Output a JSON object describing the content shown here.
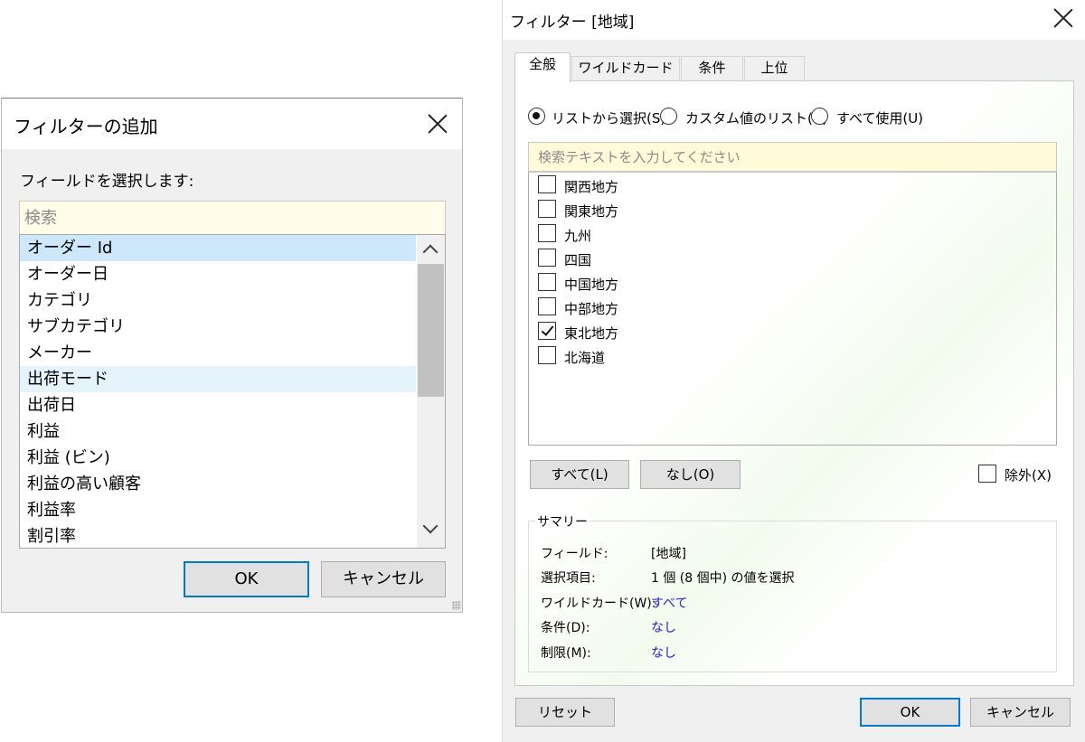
{
  "add_dialog": {
    "title": "フィルターの追加",
    "prompt": "フィールドを選択します:",
    "search_placeholder": "検索",
    "fields": [
      "オーダー Id",
      "オーダー日",
      "カテゴリ",
      "サブカテゴリ",
      "メーカー",
      "出荷モード",
      "出荷日",
      "利益",
      "利益 (ビン)",
      "利益の高い顧客",
      "利益率",
      "割引率"
    ],
    "selected_field": "オーダー Id",
    "hovered_field": "出荷モード",
    "ok_label": "OK",
    "cancel_label": "キャンセル"
  },
  "filter_dialog": {
    "title": "フィルター [地域]",
    "tabs": [
      "全般",
      "ワイルドカード",
      "条件",
      "上位"
    ],
    "active_tab": "全般",
    "radios": [
      {
        "label": "リストから選択(S)",
        "checked": true
      },
      {
        "label": "カスタム値のリスト(C)",
        "checked": false
      },
      {
        "label": "すべて使用(U)",
        "checked": false
      }
    ],
    "search_placeholder": "検索テキストを入力してください",
    "values": [
      {
        "label": "関西地方",
        "checked": false
      },
      {
        "label": "関東地方",
        "checked": false
      },
      {
        "label": "九州",
        "checked": false
      },
      {
        "label": "四国",
        "checked": false
      },
      {
        "label": "中国地方",
        "checked": false
      },
      {
        "label": "中部地方",
        "checked": false
      },
      {
        "label": "東北地方",
        "checked": true
      },
      {
        "label": "北海道",
        "checked": false
      }
    ],
    "all_label": "すべて(L)",
    "none_label": "なし(O)",
    "exclude_label": "除外(X)",
    "exclude_checked": false,
    "summary": {
      "title": "サマリー",
      "rows": [
        {
          "key": "フィールド:",
          "value": "[地域]",
          "link": false
        },
        {
          "key": "選択項目:",
          "value": "1 個 (8 個中) の値を選択",
          "link": false
        },
        {
          "key": "ワイルドカード(W):",
          "value": "すべて",
          "link": true
        },
        {
          "key": "条件(D):",
          "value": "なし",
          "link": true
        },
        {
          "key": "制限(M):",
          "value": "なし",
          "link": true
        }
      ]
    },
    "reset_label": "リセット",
    "ok_label": "OK",
    "cancel_label": "キャンセル"
  },
  "colors": {
    "selection": "#cde8fb",
    "hover": "#e5f3fc",
    "search_bg": "#fffbd9",
    "default_button_border": "#0078d7",
    "link": "#2222cc"
  }
}
